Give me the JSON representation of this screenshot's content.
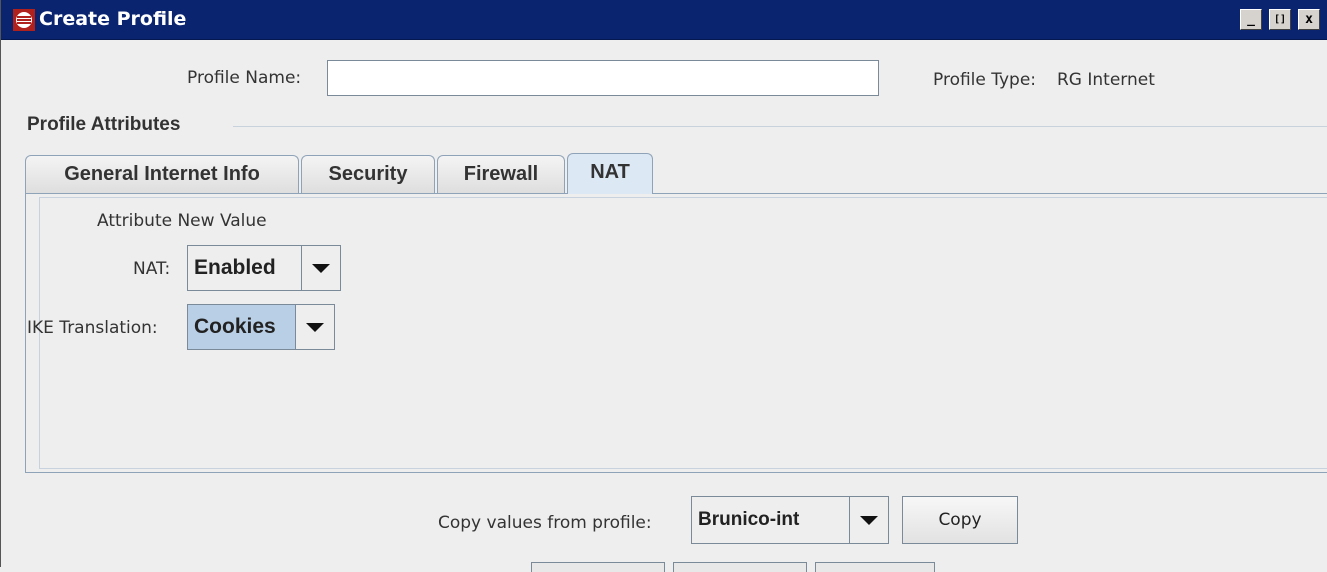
{
  "window": {
    "title": "Create Profile",
    "controls": {
      "minimize": "_",
      "maximize": "[]",
      "close": "x"
    }
  },
  "profile": {
    "name_label": "Profile Name:",
    "name_value": "",
    "type_label": "Profile Type:",
    "type_value": "RG Internet"
  },
  "attributes": {
    "section_title": "Profile Attributes",
    "tabs": [
      {
        "label": "General Internet Info",
        "active": false
      },
      {
        "label": "Security",
        "active": false
      },
      {
        "label": "Firewall",
        "active": false
      },
      {
        "label": "NAT",
        "active": true
      }
    ],
    "nat_panel": {
      "header": "Attribute New Value",
      "rows": [
        {
          "label": "NAT:",
          "value": "Enabled"
        },
        {
          "label": "IKE Translation:",
          "value": "Cookies"
        }
      ]
    }
  },
  "copy": {
    "label": "Copy values from profile:",
    "selected_profile": "Brunico-int",
    "button_label": "Copy"
  },
  "colors": {
    "titlebar": "#0a2470",
    "active_tab": "#dde8f5",
    "selection": "#b8cfe5"
  },
  "icons": {
    "app": "app-logo-icon",
    "dropdown": "chevron-down-icon"
  }
}
